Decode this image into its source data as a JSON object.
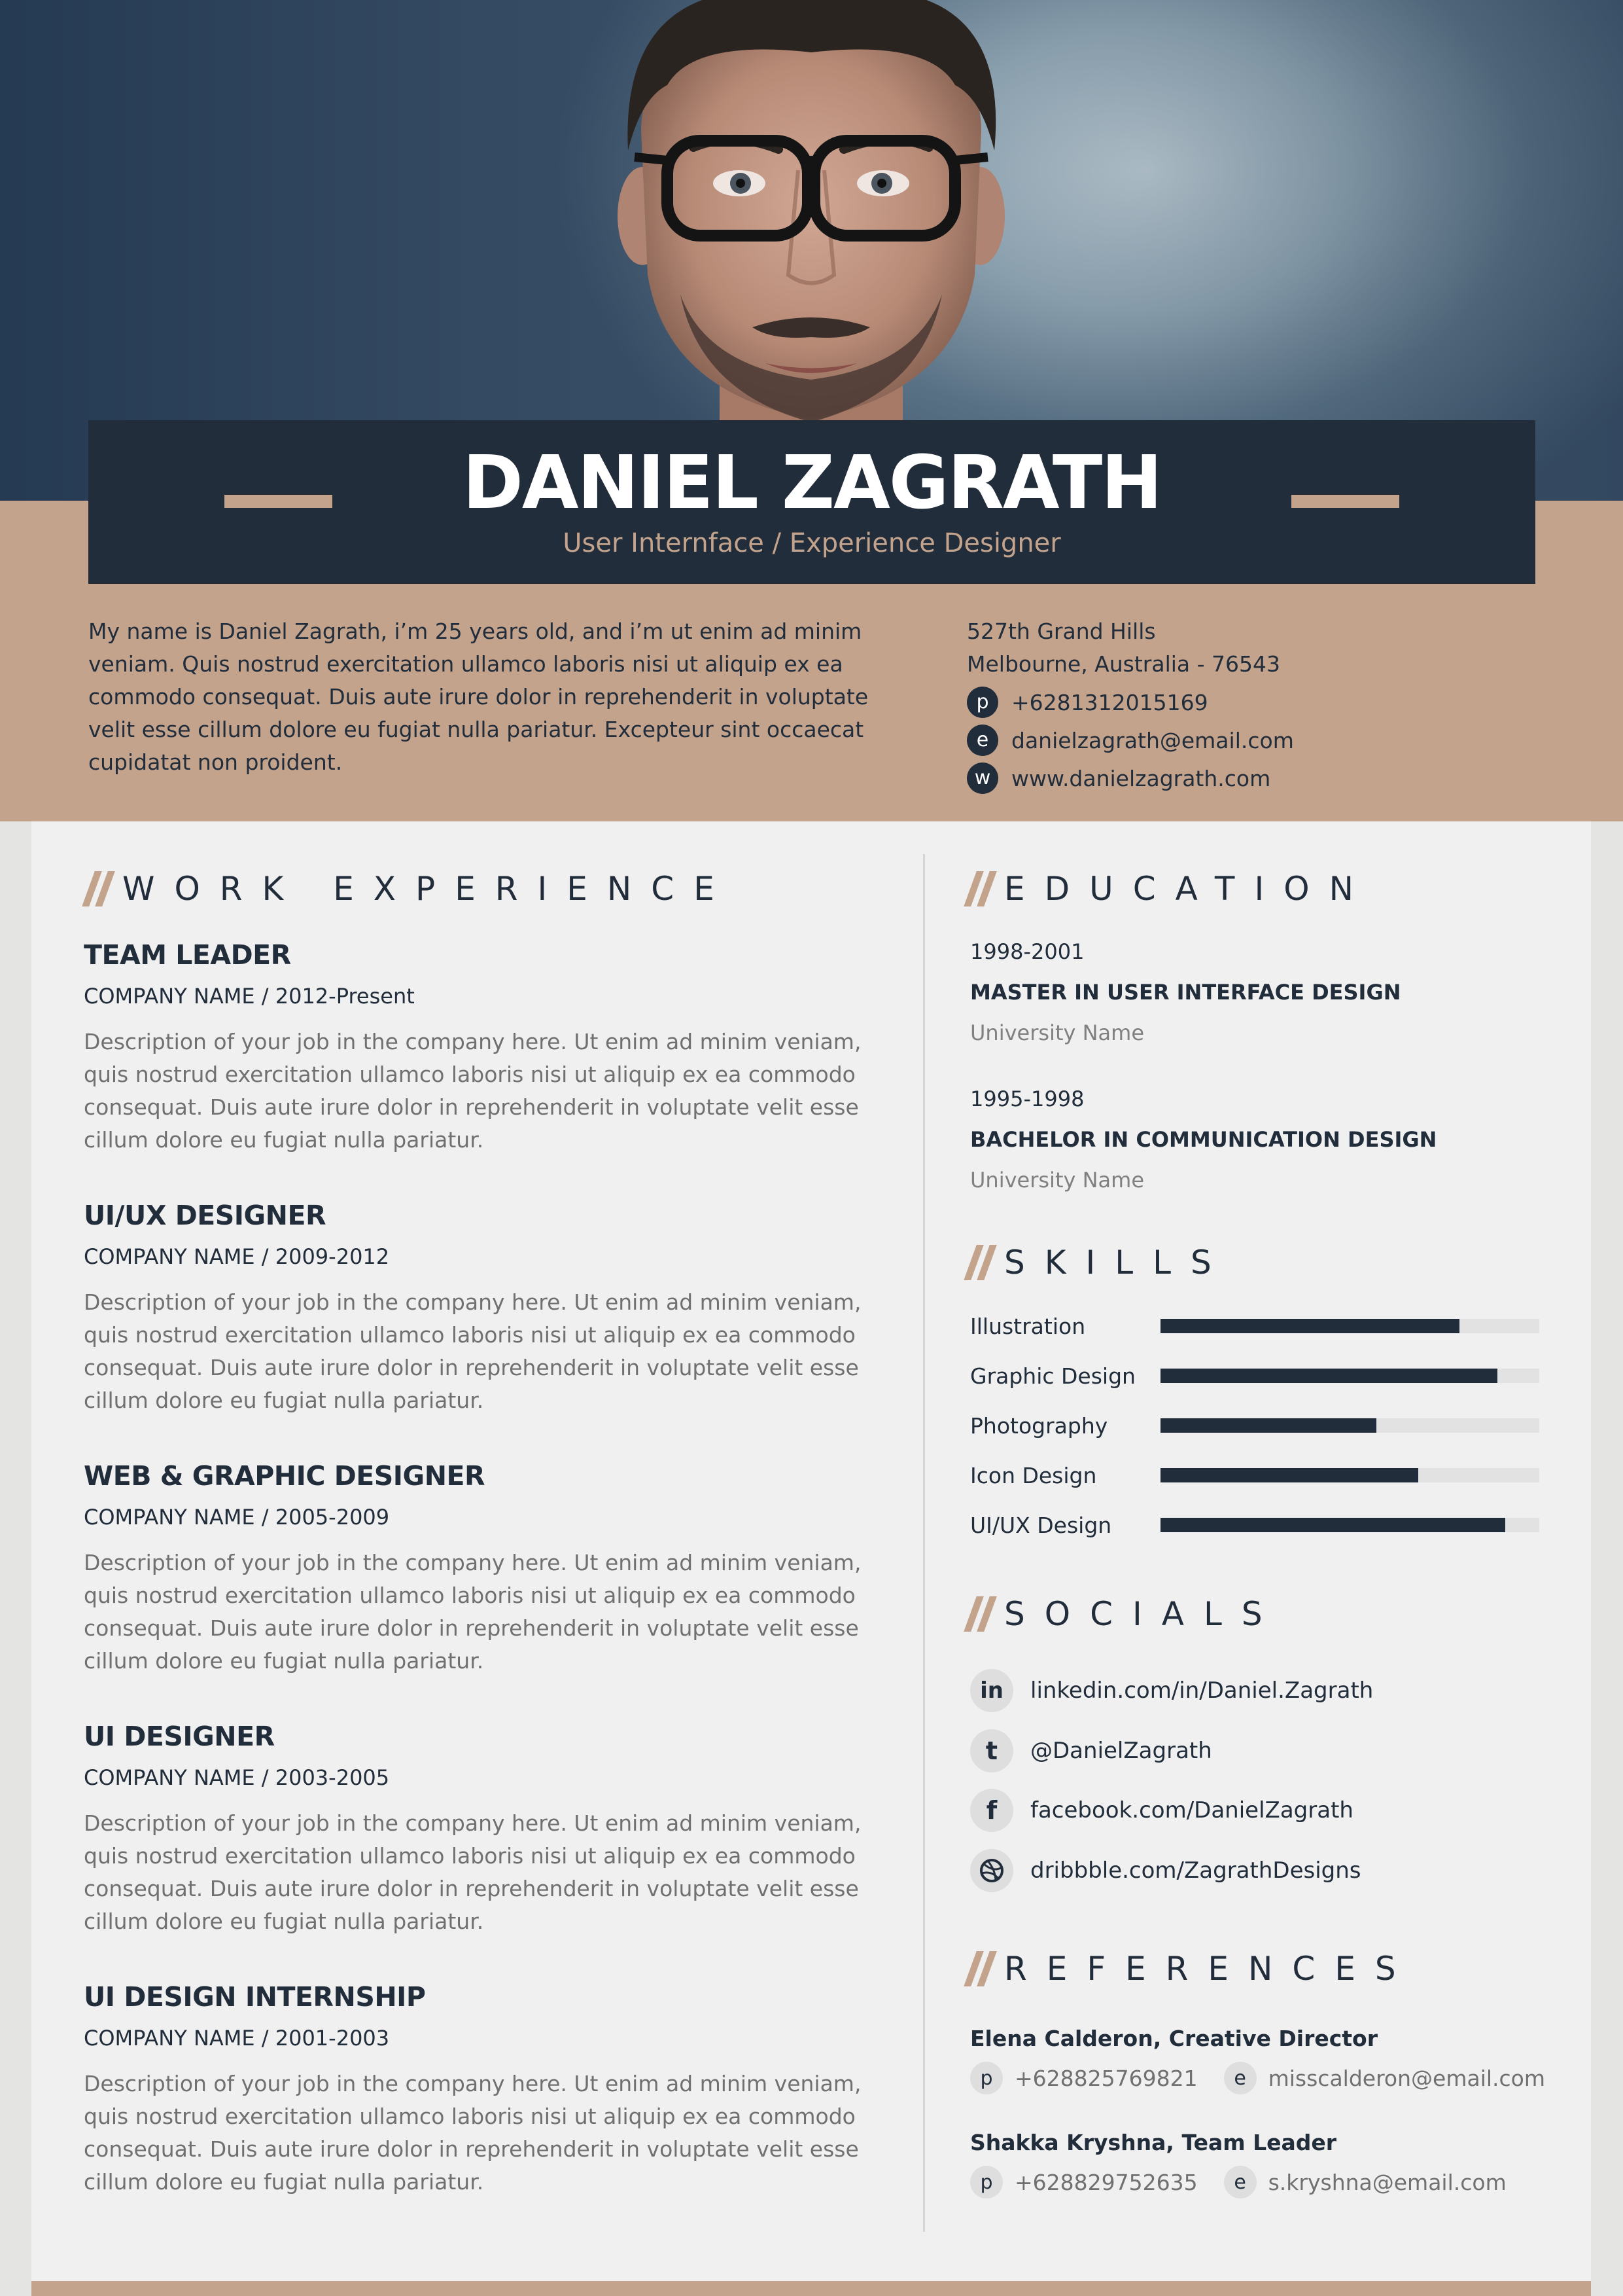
{
  "header": {
    "name": "DANIEL ZAGRATH",
    "subtitle": "User Internface / Experience Designer"
  },
  "intro": "My name is Daniel Zagrath, i’m 25 years old, and i’m ut enim ad minim veniam. Quis nostrud exercitation ullamco laboris nisi ut aliquip ex ea commodo consequat. Duis aute irure dolor in reprehenderit in voluptate velit esse cillum dolore eu fugiat nulla pariatur. Excepteur sint occaecat cupidatat non proident.",
  "contact": {
    "address_line1": "527th Grand Hills",
    "address_line2": "Melbourne, Australia - 76543",
    "phone_icon": "p",
    "phone": "+6281312015169",
    "email_icon": "e",
    "email": "danielzagrath@email.com",
    "web_icon": "w",
    "website": "www.danielzagrath.com"
  },
  "work": {
    "title": "WORK EXPERIENCE",
    "jobs": [
      {
        "title": "TEAM LEADER",
        "company": "COMPANY NAME / 2012-Present",
        "desc": "Description of your job in the company here. Ut enim ad minim veniam, quis nostrud exercitation ullamco laboris nisi ut aliquip ex ea commodo consequat. Duis aute irure dolor in reprehenderit in voluptate velit esse cillum dolore eu fugiat nulla pariatur."
      },
      {
        "title": "UI/UX DESIGNER",
        "company": "COMPANY NAME / 2009-2012",
        "desc": "Description of your job in the company here. Ut enim ad minim veniam, quis nostrud exercitation ullamco laboris nisi ut aliquip ex ea commodo consequat. Duis aute irure dolor in reprehenderit in voluptate velit esse cillum dolore eu fugiat nulla pariatur."
      },
      {
        "title": "WEB & GRAPHIC DESIGNER",
        "company": "COMPANY NAME / 2005-2009",
        "desc": "Description of your job in the company here. Ut enim ad minim veniam, quis nostrud exercitation ullamco laboris nisi ut aliquip ex ea commodo consequat. Duis aute irure dolor in reprehenderit in voluptate velit esse cillum dolore eu fugiat nulla pariatur."
      },
      {
        "title": "UI DESIGNER",
        "company": "COMPANY NAME / 2003-2005",
        "desc": "Description of your job in the company here. Ut enim ad minim veniam, quis nostrud exercitation ullamco laboris nisi ut aliquip ex ea commodo consequat. Duis aute irure dolor in reprehenderit in voluptate velit esse cillum dolore eu fugiat nulla pariatur."
      },
      {
        "title": "UI DESIGN INTERNSHIP",
        "company": "COMPANY NAME / 2001-2003",
        "desc": "Description of your job in the company here. Ut enim ad minim veniam, quis nostrud exercitation ullamco laboris nisi ut aliquip ex ea commodo consequat. Duis aute irure dolor in reprehenderit in voluptate velit esse cillum dolore eu fugiat nulla pariatur."
      }
    ]
  },
  "education": {
    "title": "EDUCATION",
    "items": [
      {
        "years": "1998-2001",
        "degree": "MASTER IN USER INTERFACE DESIGN",
        "school": "University Name"
      },
      {
        "years": "1995-1998",
        "degree": "BACHELOR IN COMMUNICATION DESIGN",
        "school": "University Name"
      }
    ]
  },
  "skills": {
    "title": "SKILLS",
    "items": [
      {
        "name": "Illustration",
        "level": 0.79
      },
      {
        "name": "Graphic Design",
        "level": 0.89
      },
      {
        "name": "Photography",
        "level": 0.57
      },
      {
        "name": "Icon Design",
        "level": 0.68
      },
      {
        "name": "UI/UX Design",
        "level": 0.91
      }
    ]
  },
  "socials": {
    "title": "SOCIALS",
    "items": [
      {
        "icon": "linkedin-icon",
        "glyph": "in",
        "text": "linkedin.com/in/Daniel.Zagrath"
      },
      {
        "icon": "twitter-icon",
        "glyph": "t",
        "text": "@DanielZagrath"
      },
      {
        "icon": "facebook-icon",
        "glyph": "f",
        "text": "facebook.com/DanielZagrath"
      },
      {
        "icon": "dribbble-icon",
        "glyph": "",
        "text": "dribbble.com/ZagrathDesigns"
      }
    ]
  },
  "references": {
    "title": "REFERENCES",
    "items": [
      {
        "name": "Elena Calderon, Creative Director",
        "phone_icon": "p",
        "phone": "+628825769821",
        "email_icon": "e",
        "email": "misscalderon@email.com"
      },
      {
        "name": "Shakka Kryshna, Team Leader",
        "phone_icon": "p",
        "phone": "+628829752635",
        "email_icon": "e",
        "email": "s.kryshna@email.com"
      }
    ]
  },
  "colors": {
    "navy": "#222d3b",
    "tan": "#c4a38c",
    "panel": "#f0f0f0",
    "muted_text": "#707070"
  }
}
